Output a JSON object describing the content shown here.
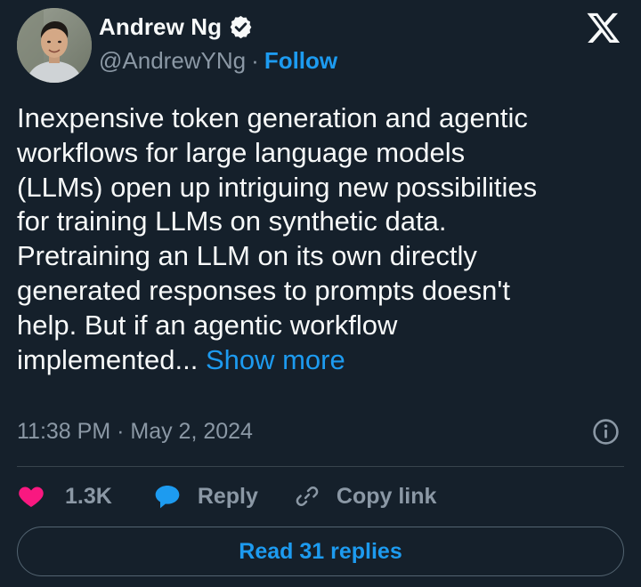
{
  "author": {
    "name": "Andrew Ng",
    "handle": "@AndrewYNg",
    "separator": "·",
    "follow_label": "Follow",
    "verified_icon": "verified-badge-icon"
  },
  "brand": {
    "logo_icon": "x-logo-icon"
  },
  "tweet": {
    "text": "Inexpensive token generation and agentic\nworkflows for large language models\n(LLMs) open up intriguing new possibilities\nfor training LLMs on synthetic data.\nPretraining an LLM on its own directly\ngenerated responses to prompts doesn't\nhelp. But if an agentic workflow\nimplemented... ",
    "show_more_label": "Show more",
    "timestamp": "11:38 PM · May 2, 2024",
    "info_icon": "info-icon"
  },
  "actions": {
    "like_icon": "heart-icon",
    "like_count": "1.3K",
    "reply_icon": "speech-bubble-icon",
    "reply_label": "Reply",
    "copy_icon": "link-icon",
    "copy_label": "Copy link"
  },
  "footer": {
    "read_replies_label": "Read 31 replies"
  },
  "colors": {
    "background": "#15202b",
    "text": "#f7f9f9",
    "muted": "#8b98a5",
    "accent": "#1d9bf0",
    "like": "#f91880",
    "border": "#536471"
  }
}
